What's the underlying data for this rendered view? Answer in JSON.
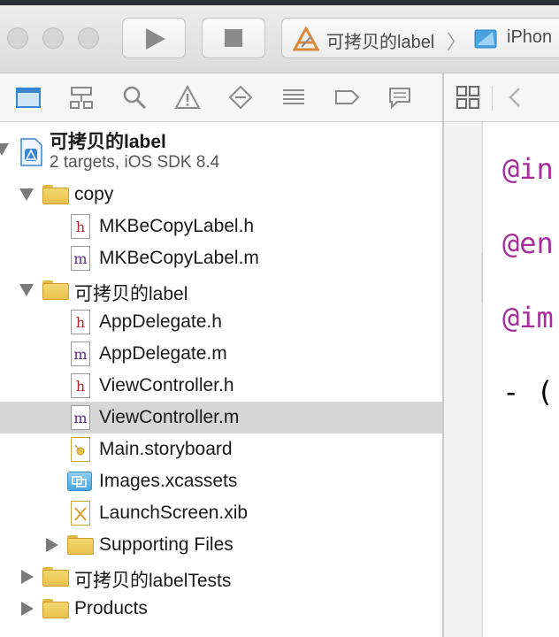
{
  "toolbar": {
    "run_icon": "play-icon",
    "stop_icon": "stop-icon",
    "scheme_name": "可拷贝的label",
    "separator": "〉",
    "destination": "iPhon"
  },
  "navigator": {
    "icons": [
      "project-navigator-icon",
      "symbol-navigator-icon",
      "find-navigator-icon",
      "issue-navigator-icon",
      "test-navigator-icon",
      "debug-navigator-icon",
      "breakpoint-navigator-icon",
      "report-navigator-icon"
    ],
    "selected": "project-navigator-icon"
  },
  "project": {
    "title": "可拷贝的label",
    "subtitle": "2 targets, iOS SDK 8.4"
  },
  "tree": [
    {
      "label": "copy",
      "kind": "folder",
      "expanded": true
    },
    {
      "label": "MKBeCopyLabel.h",
      "kind": "h"
    },
    {
      "label": "MKBeCopyLabel.m",
      "kind": "m"
    },
    {
      "label": "可拷贝的label",
      "kind": "folder",
      "expanded": true
    },
    {
      "label": "AppDelegate.h",
      "kind": "h"
    },
    {
      "label": "AppDelegate.m",
      "kind": "m"
    },
    {
      "label": "ViewController.h",
      "kind": "h"
    },
    {
      "label": "ViewController.m",
      "kind": "m",
      "selected": true
    },
    {
      "label": "Main.storyboard",
      "kind": "storyboard"
    },
    {
      "label": "Images.xcassets",
      "kind": "xcassets"
    },
    {
      "label": "LaunchScreen.xib",
      "kind": "xib"
    },
    {
      "label": "Supporting Files",
      "kind": "folder",
      "expanded": false
    },
    {
      "label": "可拷贝的labelTests",
      "kind": "folder",
      "expanded": false
    },
    {
      "label": "Products",
      "kind": "folder",
      "expanded": false
    }
  ],
  "editor": {
    "back_icon": "back-chevron-icon",
    "related_icon": "related-items-icon",
    "lines": [
      "@in",
      "@en",
      "@im",
      "- ("
    ]
  },
  "colors": {
    "keyword": "#a52f9a",
    "selection": "#d6d6d6",
    "folder": "#f0cf5e"
  }
}
